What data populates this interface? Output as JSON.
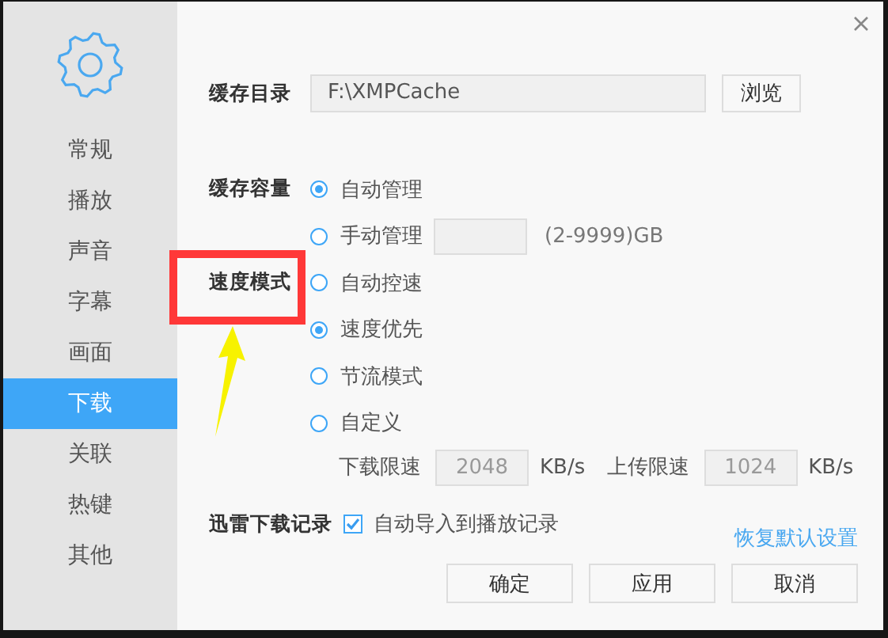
{
  "sidebar": {
    "items": [
      {
        "label": "常规",
        "selected": false
      },
      {
        "label": "播放",
        "selected": false
      },
      {
        "label": "声音",
        "selected": false
      },
      {
        "label": "字幕",
        "selected": false
      },
      {
        "label": "画面",
        "selected": false
      },
      {
        "label": "下载",
        "selected": true
      },
      {
        "label": "关联",
        "selected": false
      },
      {
        "label": "热键",
        "selected": false
      },
      {
        "label": "其他",
        "selected": false
      }
    ]
  },
  "cache_dir": {
    "label": "缓存目录",
    "value": "F:\\XMPCache",
    "browse": "浏览"
  },
  "cache_size": {
    "label": "缓存容量",
    "options": [
      {
        "label": "自动管理",
        "selected": true,
        "kind": "plain"
      },
      {
        "label": "手动管理",
        "selected": false,
        "kind": "input",
        "hint": "(2-9999)GB"
      }
    ]
  },
  "speed_mode": {
    "label": "速度模式",
    "options": [
      {
        "label": "自动控速",
        "selected": false
      },
      {
        "label": "速度优先",
        "selected": true
      },
      {
        "label": "节流模式",
        "selected": false
      },
      {
        "label": "自定义",
        "selected": false
      }
    ],
    "limits": [
      {
        "label": "下载限速",
        "value": "2048",
        "unit": "KB/s",
        "disabled": true
      },
      {
        "label": "上传限速",
        "value": "1024",
        "unit": "KB/s",
        "disabled": true
      }
    ]
  },
  "record": {
    "label": "迅雷下载记录",
    "checkbox": {
      "label": "自动导入到播放记录",
      "checked": true
    }
  },
  "restore_link": "恢复默认设置",
  "buttons": [
    "确定",
    "应用",
    "取消"
  ],
  "annotations": {
    "frame": true,
    "arrow": true
  }
}
